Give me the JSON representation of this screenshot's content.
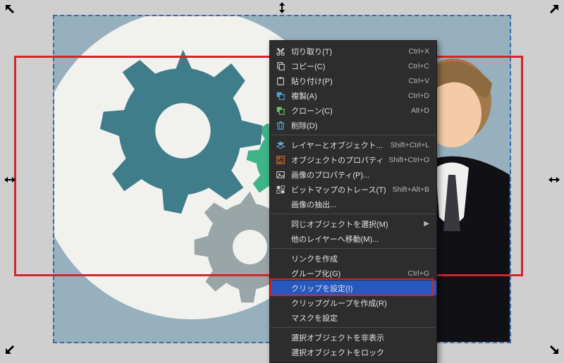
{
  "menu": {
    "items": [
      {
        "icon": "cut",
        "label": "切り取り(T)",
        "shortcut": "Ctrl+X"
      },
      {
        "icon": "copy",
        "label": "コピー(C)",
        "shortcut": "Ctrl+C"
      },
      {
        "icon": "paste",
        "label": "貼り付け(P)",
        "shortcut": "Ctrl+V"
      },
      {
        "icon": "duplicate",
        "label": "複製(A)",
        "shortcut": "Ctrl+D"
      },
      {
        "icon": "clone",
        "label": "クローン(C)",
        "shortcut": "Alt+D"
      },
      {
        "icon": "delete",
        "label": "削除(D)",
        "shortcut": ""
      },
      {
        "sep": true
      },
      {
        "icon": "layers",
        "label": "レイヤーとオブジェクト...",
        "shortcut": "Shift+Ctrl+L"
      },
      {
        "icon": "props",
        "label": "オブジェクトのプロパティ(O)...",
        "shortcut": "Shift+Ctrl+O"
      },
      {
        "icon": "imgprops",
        "label": "画像のプロパティ(P)...",
        "shortcut": ""
      },
      {
        "icon": "trace",
        "label": "ビットマップのトレース(T)...",
        "shortcut": "Shift+Alt+B"
      },
      {
        "icon": "",
        "label": "画像の抽出...",
        "shortcut": ""
      },
      {
        "sep": true
      },
      {
        "icon": "",
        "label": "同じオブジェクトを選択(M)",
        "shortcut": "",
        "submenu": true
      },
      {
        "icon": "",
        "label": "他のレイヤーへ移動(M)...",
        "shortcut": ""
      },
      {
        "sep": true
      },
      {
        "icon": "",
        "label": "リンクを作成",
        "shortcut": ""
      },
      {
        "icon": "",
        "label": "グループ化(G)",
        "shortcut": "Ctrl+G"
      },
      {
        "icon": "",
        "label": "クリップを設定(I)",
        "shortcut": "",
        "highlight": true
      },
      {
        "icon": "",
        "label": "クリップグループを作成(R)",
        "shortcut": ""
      },
      {
        "icon": "",
        "label": "マスクを設定",
        "shortcut": ""
      },
      {
        "sep": true
      },
      {
        "icon": "",
        "label": "選択オブジェクトを非表示",
        "shortcut": ""
      },
      {
        "icon": "",
        "label": "選択オブジェクトをロック",
        "shortcut": ""
      }
    ]
  }
}
